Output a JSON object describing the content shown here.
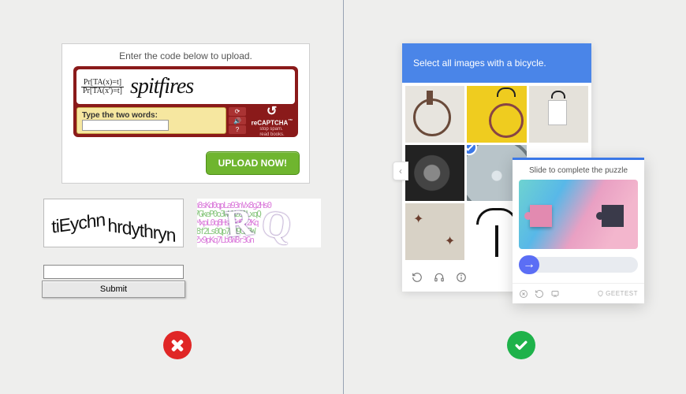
{
  "left": {
    "card_title": "Enter the code below to upload.",
    "recaptcha": {
      "math_top": "Pr[TA(x)=t]",
      "math_bot": "Pr[TA(x')=t]",
      "word": "spitfires",
      "input_label": "Type the two words:",
      "logo_prefix": "re",
      "logo_main": "CAPTCHA",
      "logo_tm": "™",
      "logo_line1": "stop spam.",
      "logo_line2": "read books."
    },
    "upload_label": "UPLOAD NOW!",
    "blob1_a": "tiEychn",
    "blob1_b": "hrdythryn",
    "submit_label": "Submit"
  },
  "right": {
    "grid_title": "Select all images with a bicycle.",
    "slider_title": "Slide to complete the puzzle",
    "brand": "GEETEST"
  }
}
